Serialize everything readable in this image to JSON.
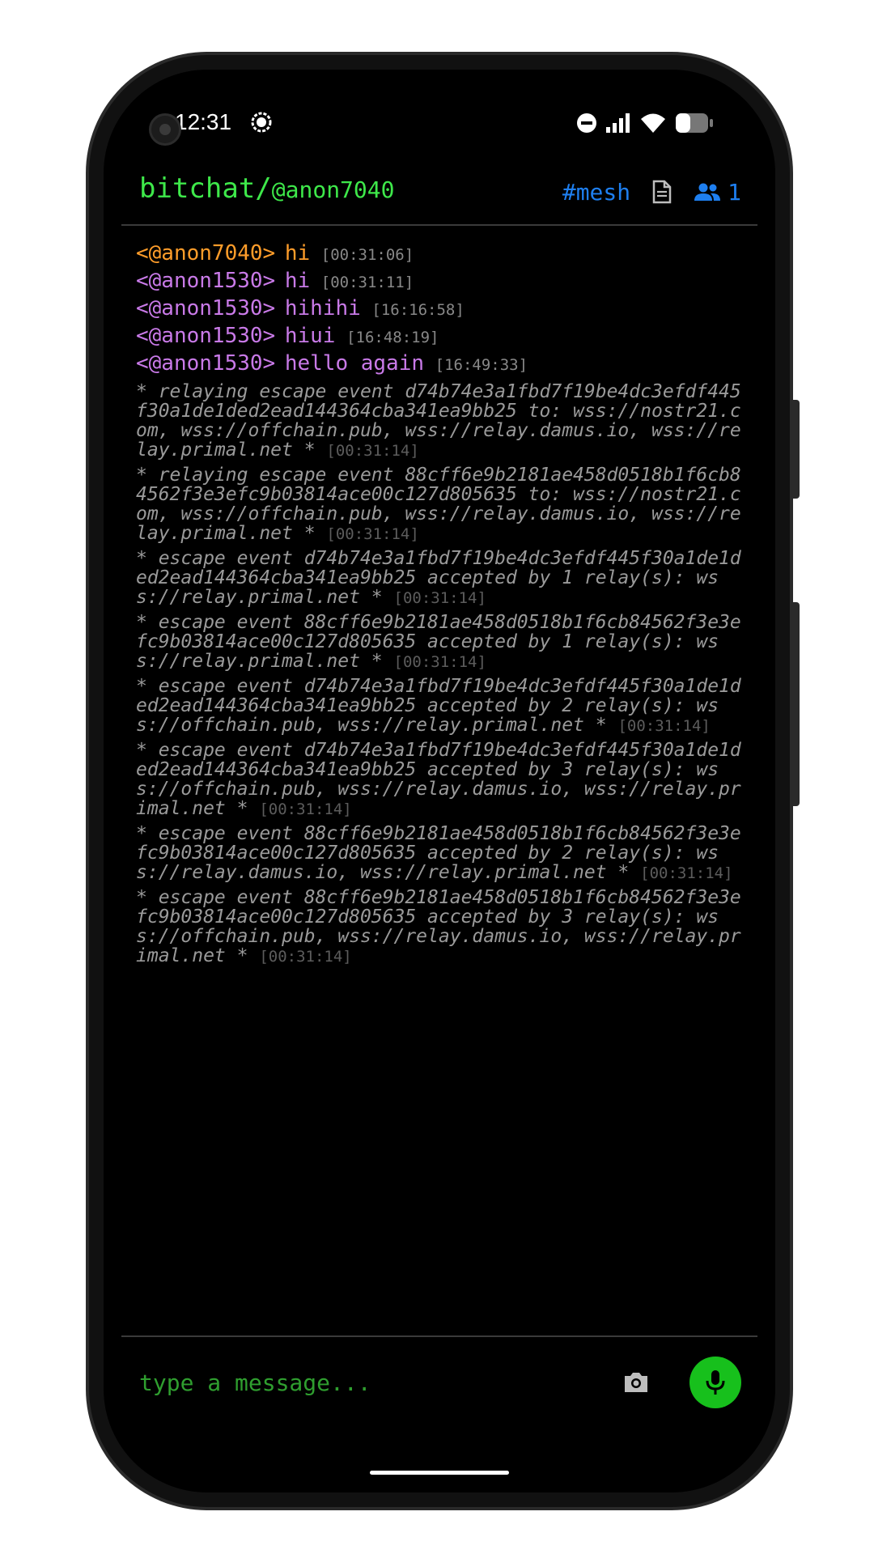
{
  "status_bar": {
    "time": "12:31"
  },
  "header": {
    "app_name": "bitchat/",
    "username": "@anon7040",
    "channel": "#mesh",
    "peer_count": "1"
  },
  "messages": [
    {
      "kind": "self",
      "sender": "<@anon7040>",
      "text": "hi",
      "time": "[00:31:06]"
    },
    {
      "kind": "peer",
      "sender": "<@anon1530>",
      "text": "hi",
      "time": "[00:31:11]"
    },
    {
      "kind": "peer",
      "sender": "<@anon1530>",
      "text": "hihihi",
      "time": "[16:16:58]"
    },
    {
      "kind": "peer",
      "sender": "<@anon1530>",
      "text": "hiui",
      "time": "[16:48:19]"
    },
    {
      "kind": "peer",
      "sender": "<@anon1530>",
      "text": "hello again",
      "time": "[16:49:33]"
    }
  ],
  "system_messages": [
    {
      "text": "* relaying escape event d74b74e3a1fbd7f19be4dc3efdf445f30a1de1ded2ead144364cba341ea9bb25 to: wss://nostr21.com, wss://offchain.pub, wss://relay.damus.io, wss://relay.primal.net *",
      "time": "[00:31:14]"
    },
    {
      "text": "* relaying escape event 88cff6e9b2181ae458d0518b1f6cb84562f3e3efc9b03814ace00c127d805635 to: wss://nostr21.com, wss://offchain.pub, wss://relay.damus.io, wss://relay.primal.net *",
      "time": "[00:31:14]"
    },
    {
      "text": "* escape event d74b74e3a1fbd7f19be4dc3efdf445f30a1de1ded2ead144364cba341ea9bb25 accepted by 1 relay(s): wss://relay.primal.net *",
      "time": "[00:31:14]"
    },
    {
      "text": "* escape event 88cff6e9b2181ae458d0518b1f6cb84562f3e3efc9b03814ace00c127d805635 accepted by 1 relay(s): wss://relay.primal.net *",
      "time": "[00:31:14]"
    },
    {
      "text": "* escape event d74b74e3a1fbd7f19be4dc3efdf445f30a1de1ded2ead144364cba341ea9bb25 accepted by 2 relay(s): wss://offchain.pub, wss://relay.primal.net *",
      "time": "[00:31:14]"
    },
    {
      "text": "* escape event d74b74e3a1fbd7f19be4dc3efdf445f30a1de1ded2ead144364cba341ea9bb25 accepted by 3 relay(s): wss://offchain.pub, wss://relay.damus.io, wss://relay.primal.net *",
      "time": "[00:31:14]"
    },
    {
      "text": "* escape event 88cff6e9b2181ae458d0518b1f6cb84562f3e3efc9b03814ace00c127d805635 accepted by 2 relay(s): wss://relay.damus.io, wss://relay.primal.net *",
      "time": "[00:31:14]"
    },
    {
      "text": "* escape event 88cff6e9b2181ae458d0518b1f6cb84562f3e3efc9b03814ace00c127d805635 accepted by 3 relay(s): wss://offchain.pub, wss://relay.damus.io, wss://relay.primal.net *",
      "time": "[00:31:14]"
    }
  ],
  "composer": {
    "placeholder": "type a message..."
  },
  "icons": {
    "notification": "bitchat-notification-icon",
    "dnd": "do-not-disturb-icon",
    "signal": "cell-signal-icon",
    "wifi": "wifi-icon",
    "battery": "battery-icon",
    "document": "document-icon",
    "people": "people-icon",
    "camera": "camera-icon",
    "mic": "mic-icon"
  },
  "colors": {
    "brand_green": "#3ee84a",
    "self_orange": "#ff9d2a",
    "peer_purple": "#c97ae8",
    "accent_blue": "#1e7ff0",
    "mic_green": "#17c01c"
  }
}
